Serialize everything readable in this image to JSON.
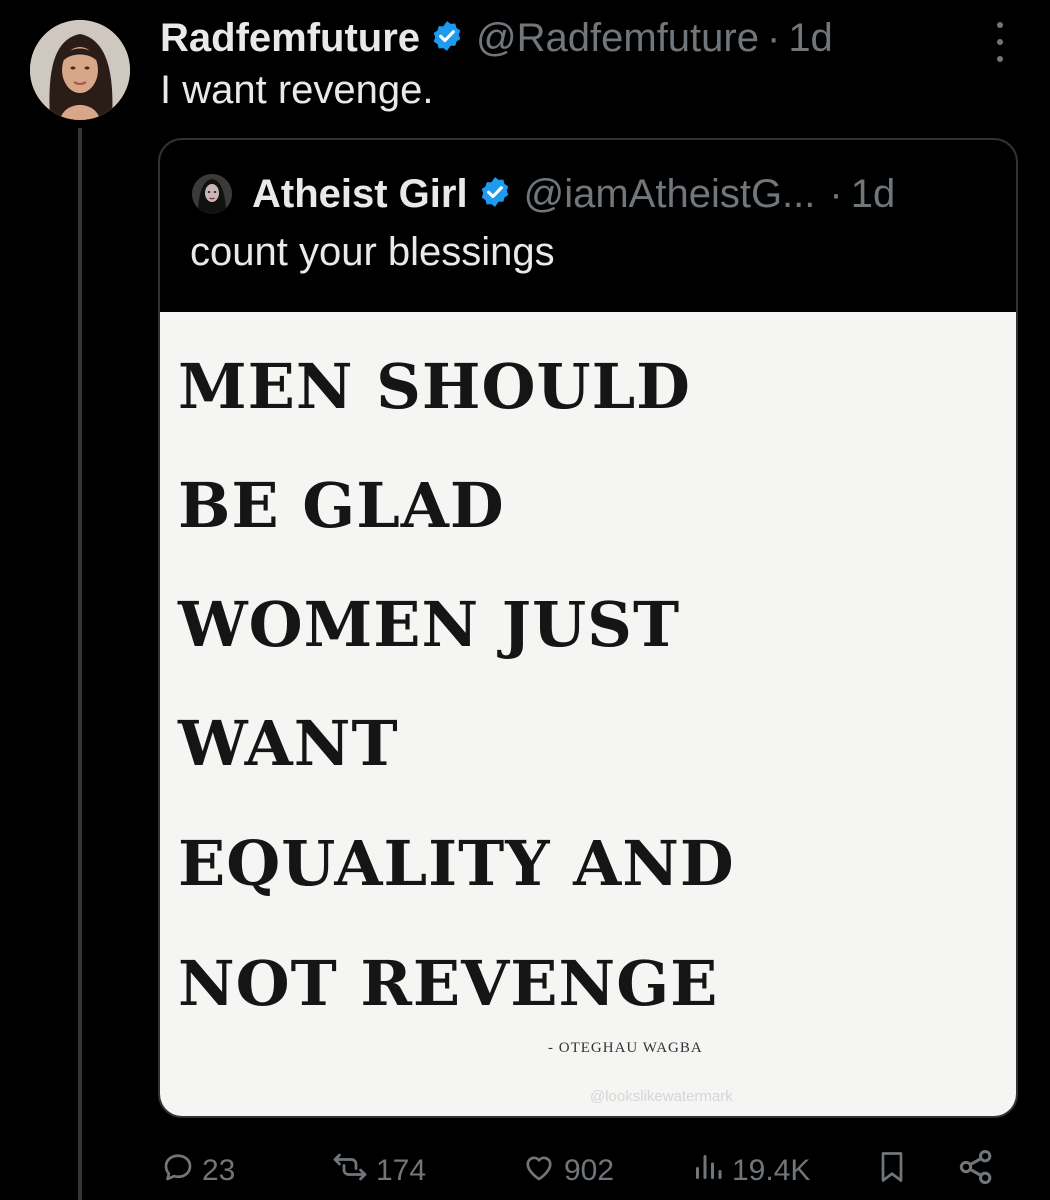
{
  "tweet": {
    "author": {
      "display_name": "Radfemfuture",
      "handle": "@Radfemfuture",
      "verified": true
    },
    "separator": "·",
    "time": "1d",
    "text": "I want revenge."
  },
  "quoted_tweet": {
    "author": {
      "display_name": "Atheist Girl",
      "handle": "@iamAtheistG...",
      "verified": true
    },
    "separator": "·",
    "time": "1d",
    "text": "count your blessings",
    "image": {
      "lines": [
        "MEN SHOULD",
        "BE GLAD",
        "WOMEN JUST",
        "WANT",
        "EQUALITY AND",
        "NOT REVENGE"
      ],
      "attribution": "- OTEGHAU WAGBA",
      "watermark": "@lookslikewatermark"
    }
  },
  "actions": {
    "replies": "23",
    "reposts": "174",
    "likes": "902",
    "views": "19.4K"
  },
  "colors": {
    "background": "#000000",
    "text_primary": "#e7e9ea",
    "text_secondary": "#71767b",
    "verified_badge": "#1d9bf0",
    "border": "#2f3336"
  }
}
